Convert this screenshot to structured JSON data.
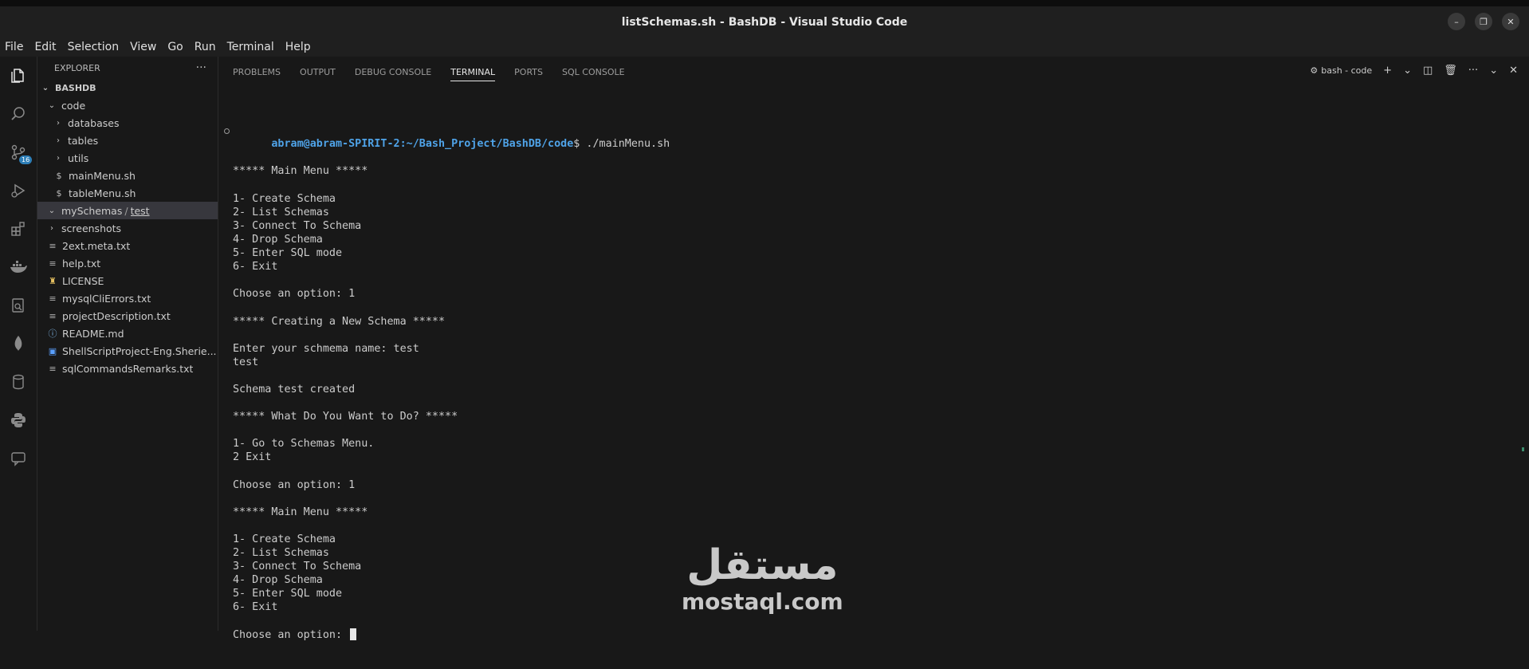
{
  "window": {
    "title": "listSchemas.sh - BashDB - Visual Studio Code",
    "controls": [
      "–",
      "❐",
      "✕"
    ]
  },
  "menu": [
    "File",
    "Edit",
    "Selection",
    "View",
    "Go",
    "Run",
    "Terminal",
    "Help"
  ],
  "activity_bar": {
    "icons": [
      "files-icon",
      "search-icon",
      "source-control-icon",
      "run-debug-icon",
      "extensions-icon",
      "docker-icon",
      "remote-explorer-icon",
      "mongodb-icon",
      "database-icon",
      "python-icon",
      "chat-icon"
    ],
    "source_control_badge": "16"
  },
  "explorer": {
    "title": "EXPLORER",
    "more": "···",
    "root": "BASHDB",
    "items": [
      {
        "label": "code",
        "kind": "folder-open",
        "depth": 1
      },
      {
        "label": "databases",
        "kind": "folder",
        "depth": 2
      },
      {
        "label": "tables",
        "kind": "folder",
        "depth": 2
      },
      {
        "label": "utils",
        "kind": "folder",
        "depth": 2
      },
      {
        "label": "mainMenu.sh",
        "kind": "sh",
        "depth": 2
      },
      {
        "label": "tableMenu.sh",
        "kind": "sh",
        "depth": 2
      },
      {
        "label": "mySchemas",
        "label_suffix": "test",
        "kind": "folder-open",
        "depth": 1,
        "selected": true
      },
      {
        "label": "screenshots",
        "kind": "folder",
        "depth": 1
      },
      {
        "label": "2ext.meta.txt",
        "kind": "txt",
        "depth": 1
      },
      {
        "label": "help.txt",
        "kind": "txt",
        "depth": 1
      },
      {
        "label": "LICENSE",
        "kind": "license",
        "depth": 1
      },
      {
        "label": "mysqlCliErrors.txt",
        "kind": "txt",
        "depth": 1
      },
      {
        "label": "projectDescription.txt",
        "kind": "txt",
        "depth": 1
      },
      {
        "label": "README.md",
        "kind": "md",
        "depth": 1
      },
      {
        "label": "ShellScriptProject-Eng.Sherie...",
        "kind": "doc",
        "depth": 1
      },
      {
        "label": "sqlCommandsRemarks.txt",
        "kind": "txt",
        "depth": 1
      }
    ]
  },
  "panel": {
    "tabs": [
      "PROBLEMS",
      "OUTPUT",
      "DEBUG CONSOLE",
      "TERMINAL",
      "PORTS",
      "SQL CONSOLE"
    ],
    "active_tab": "TERMINAL",
    "shell_label": "bash - code",
    "toolbar_icons": [
      "+",
      "⌄",
      "◫",
      "🗑",
      "···",
      "⌄",
      "✕"
    ]
  },
  "terminal": {
    "prompt_user": "abram@abram-SPIRIT-2",
    "prompt_path": ":~/Bash_Project/BashDB/code",
    "prompt_cmd": "$ ./mainMenu.sh",
    "lines": [
      "***** Main Menu *****",
      "",
      "1- Create Schema",
      "2- List Schemas",
      "3- Connect To Schema",
      "4- Drop Schema",
      "5- Enter SQL mode",
      "6- Exit",
      "",
      "Choose an option: 1",
      "",
      "***** Creating a New Schema *****",
      "",
      "Enter your schmema name: test",
      "test",
      "",
      "Schema test created",
      "",
      "***** What Do You Want to Do? *****",
      "",
      "1- Go to Schemas Menu.",
      "2 Exit",
      "",
      "Choose an option: 1",
      "",
      "***** Main Menu *****",
      "",
      "1- Create Schema",
      "2- List Schemas",
      "3- Connect To Schema",
      "4- Drop Schema",
      "5- Enter SQL mode",
      "6- Exit",
      "",
      "Choose an option: "
    ]
  },
  "watermark": {
    "arabic": "مستقل",
    "latin": "mostaql.com"
  }
}
